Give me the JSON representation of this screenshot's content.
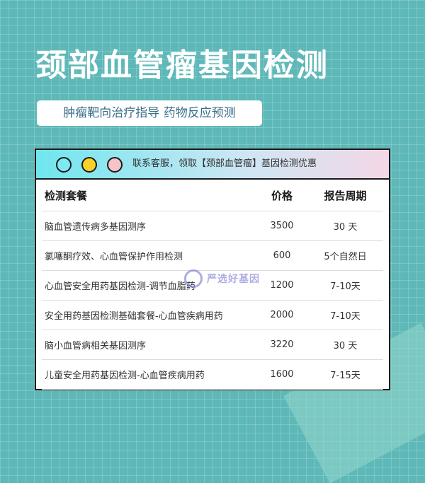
{
  "header": {
    "title": "颈部血管瘤基因检测",
    "subtitle": "肿瘤靶向治疗指导 药物反应预测"
  },
  "card": {
    "header_text": "联系客服，领取【颈部血管瘤】基因检测优惠",
    "dot_colors": [
      "#7ee9f0",
      "#f8d12a",
      "#f6c4c8"
    ],
    "table": {
      "columns": [
        "检测套餐",
        "价格",
        "报告周期"
      ],
      "rows": [
        {
          "name": "脑血管遗传病多基因测序",
          "price": "3500",
          "period": "30 天"
        },
        {
          "name": "氯噻酮疗效、心血管保护作用检测",
          "price": "600",
          "period": "5个自然日"
        },
        {
          "name": "心血管安全用药基因检测-调节血脂药",
          "price": "1200",
          "period": "7-10天"
        },
        {
          "name": "安全用药基因检测基础套餐-心血管疾病用药",
          "price": "2000",
          "period": "7-10天"
        },
        {
          "name": "脑小血管病相关基因测序",
          "price": "3220",
          "period": "30 天"
        },
        {
          "name": "儿童安全用药基因检测-心血管疾病用药",
          "price": "1600",
          "period": "7-15天"
        }
      ]
    }
  },
  "watermark": {
    "text": "严选好基因"
  },
  "colors": {
    "background": "#5fb8b8",
    "subtitle_text": "#3a6f8a",
    "border": "#1a1a1a"
  }
}
